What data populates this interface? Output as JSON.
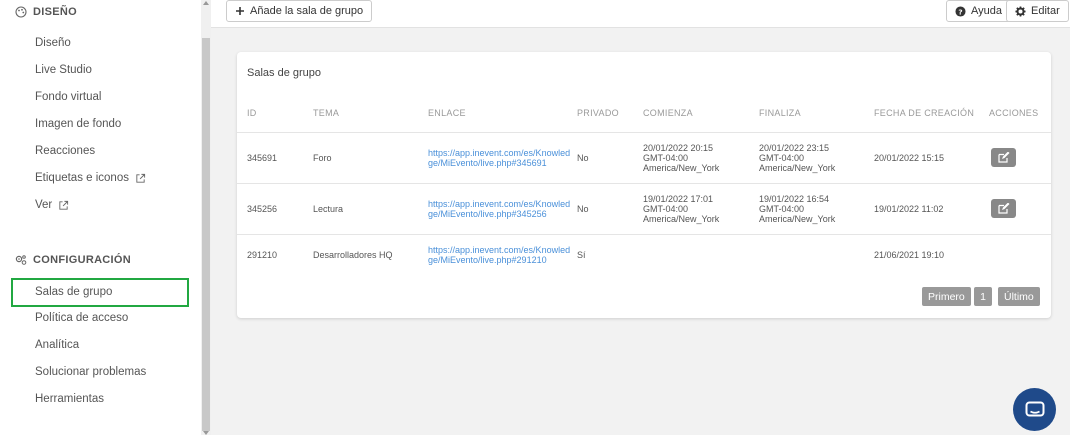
{
  "sidebar": {
    "design_heading": "DISEÑO",
    "design_items": [
      {
        "label": "Diseño"
      },
      {
        "label": "Live Studio"
      },
      {
        "label": "Fondo virtual"
      },
      {
        "label": "Imagen de fondo"
      },
      {
        "label": "Reacciones"
      },
      {
        "label": "Etiquetas e iconos"
      },
      {
        "label": "Ver"
      }
    ],
    "config_heading": "CONFIGURACIÓN",
    "config_items": [
      {
        "label": "Salas de grupo"
      },
      {
        "label": "Política de acceso"
      },
      {
        "label": "Analítica"
      },
      {
        "label": "Solucionar problemas"
      },
      {
        "label": "Herramientas"
      }
    ]
  },
  "toolbar": {
    "add_label": "Añade la sala de grupo",
    "help_label": "Ayuda",
    "edit_label": "Editar"
  },
  "card": {
    "title": "Salas de grupo",
    "columns": [
      "ID",
      "TEMA",
      "ENLACE",
      "PRIVADO",
      "COMIENZA",
      "FINALIZA",
      "FECHA DE CREACIÓN",
      "ACCIONES"
    ],
    "rows": [
      {
        "id": "345691",
        "tema": "Foro",
        "link_1": "https://app.inevent.com/es/Knowled",
        "link_2": "ge/MiEvento/live.php#345691",
        "privado": "No",
        "start_1": "20/01/2022 20:15",
        "start_2": "GMT-04:00",
        "start_3": "America/New_York",
        "end_1": "20/01/2022 23:15",
        "end_2": "GMT-04:00",
        "end_3": "America/New_York",
        "created": "20/01/2022 15:15"
      },
      {
        "id": "345256",
        "tema": "Lectura",
        "link_1": "https://app.inevent.com/es/Knowled",
        "link_2": "ge/MiEvento/live.php#345256",
        "privado": "No",
        "start_1": "19/01/2022 17:01",
        "start_2": "GMT-04:00",
        "start_3": "America/New_York",
        "end_1": "19/01/2022 16:54",
        "end_2": "GMT-04:00",
        "end_3": "America/New_York",
        "created": "19/01/2022 11:02"
      },
      {
        "id": "291210",
        "tema": "Desarrolladores HQ",
        "link_1": "https://app.inevent.com/es/Knowled",
        "link_2": "ge/MiEvento/live.php#291210",
        "privado": "Sí",
        "created": "21/06/2021 19:10"
      }
    ],
    "pagination": {
      "first": "Primero",
      "page": "1",
      "last": "Último"
    }
  },
  "colors": {
    "active_outline": "#21a841",
    "link": "#4a90d9",
    "chat_bubble": "#1f4a8a"
  },
  "icons": [
    "palette-icon",
    "external-link-icon",
    "gears-icon",
    "plus-icon",
    "question-circle-icon",
    "gear-icon",
    "edit-icon",
    "chat-icon"
  ]
}
